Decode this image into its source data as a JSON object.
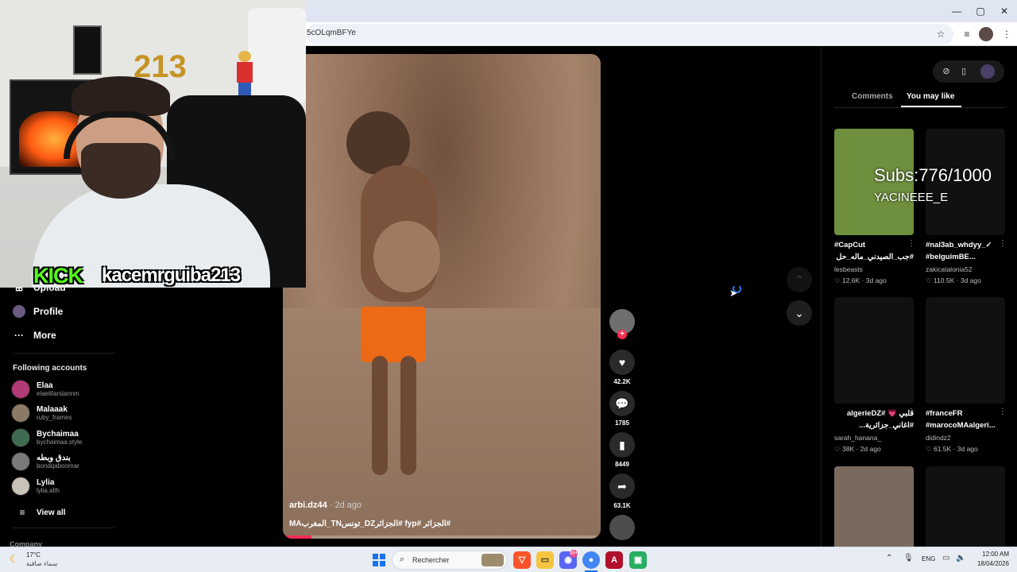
{
  "browser": {
    "url": "5cOLqmBFYe",
    "window_controls": [
      "—",
      "▢",
      "✕"
    ]
  },
  "sidebar": {
    "items": [
      {
        "label": "Upload",
        "icon": "upload-icon"
      },
      {
        "label": "Profile",
        "icon": "profile-avatar-icon"
      },
      {
        "label": "More",
        "icon": "more-dots-icon"
      }
    ],
    "following_heading": "Following accounts",
    "accounts": [
      {
        "name": "Elaa",
        "handle": "elaelifarslannm"
      },
      {
        "name": "Malaaak",
        "handle": "ruby_frames"
      },
      {
        "name": "Bychaimaa",
        "handle": "bychaimaa.style"
      },
      {
        "name": "بندق وبطه",
        "handle": "bondqaboomar"
      },
      {
        "name": "Lylia",
        "handle": "lylia.alth"
      }
    ],
    "view_all": "View all",
    "company": "Company"
  },
  "video": {
    "author": "arbi.dz44",
    "date": "· 2d ago",
    "caption": "#الجزائر #fyp #الجزائرDZ_تونسTN_المغربMA",
    "progress": 0.09
  },
  "rail": {
    "likes": "42.2K",
    "comments": "1785",
    "saves": "8449",
    "shares": "63.1K"
  },
  "right_panel": {
    "tabs": [
      "Comments",
      "You may like"
    ],
    "active_tab": "You may like",
    "cards": [
      {
        "title1": "#CapCut",
        "title2": "#جب_الصيدني_ماله_حل",
        "user": "lesbeasts",
        "views": "12.6K",
        "age": "3d ago",
        "thumb": "#6e8f3e"
      },
      {
        "title1": "#nal3ab_whdyy_✓",
        "title2": "#belguimBE...",
        "user": "zakicatalonia52",
        "views": "110.5K",
        "age": "3d ago",
        "thumb": "#111111"
      },
      {
        "title1": "قلبي 💗 #algerieDZ",
        "title2": "#اغاني_جزائرية...",
        "user": "sarah_hanana_",
        "views": "38K",
        "age": "2d ago",
        "thumb": "#111111"
      },
      {
        "title1": "#franceFR",
        "title2": "#marocoMAalgeri...",
        "user": "didindz2",
        "views": "61.5K",
        "age": "3d ago",
        "thumb": "#111111"
      },
      {
        "title1": "",
        "title2": "",
        "user": "",
        "views": "",
        "age": "",
        "thumb": "#7a6a5e"
      },
      {
        "title1": "",
        "title2": "",
        "user": "",
        "views": "",
        "age": "",
        "thumb": "#111111"
      }
    ]
  },
  "overlay": {
    "subs": "Subs:776/1000",
    "name": "YACINEEE_E"
  },
  "webcam": {
    "kick": "KICK",
    "username": "kacemrguiba213",
    "balloons": "213"
  },
  "taskbar": {
    "temp": "17°C",
    "condition": "سماء صافية",
    "search": "Rechercher",
    "lang": "ENG",
    "time": "12:00 AM",
    "date": "18/04/2026",
    "discord_badge": "99+"
  }
}
